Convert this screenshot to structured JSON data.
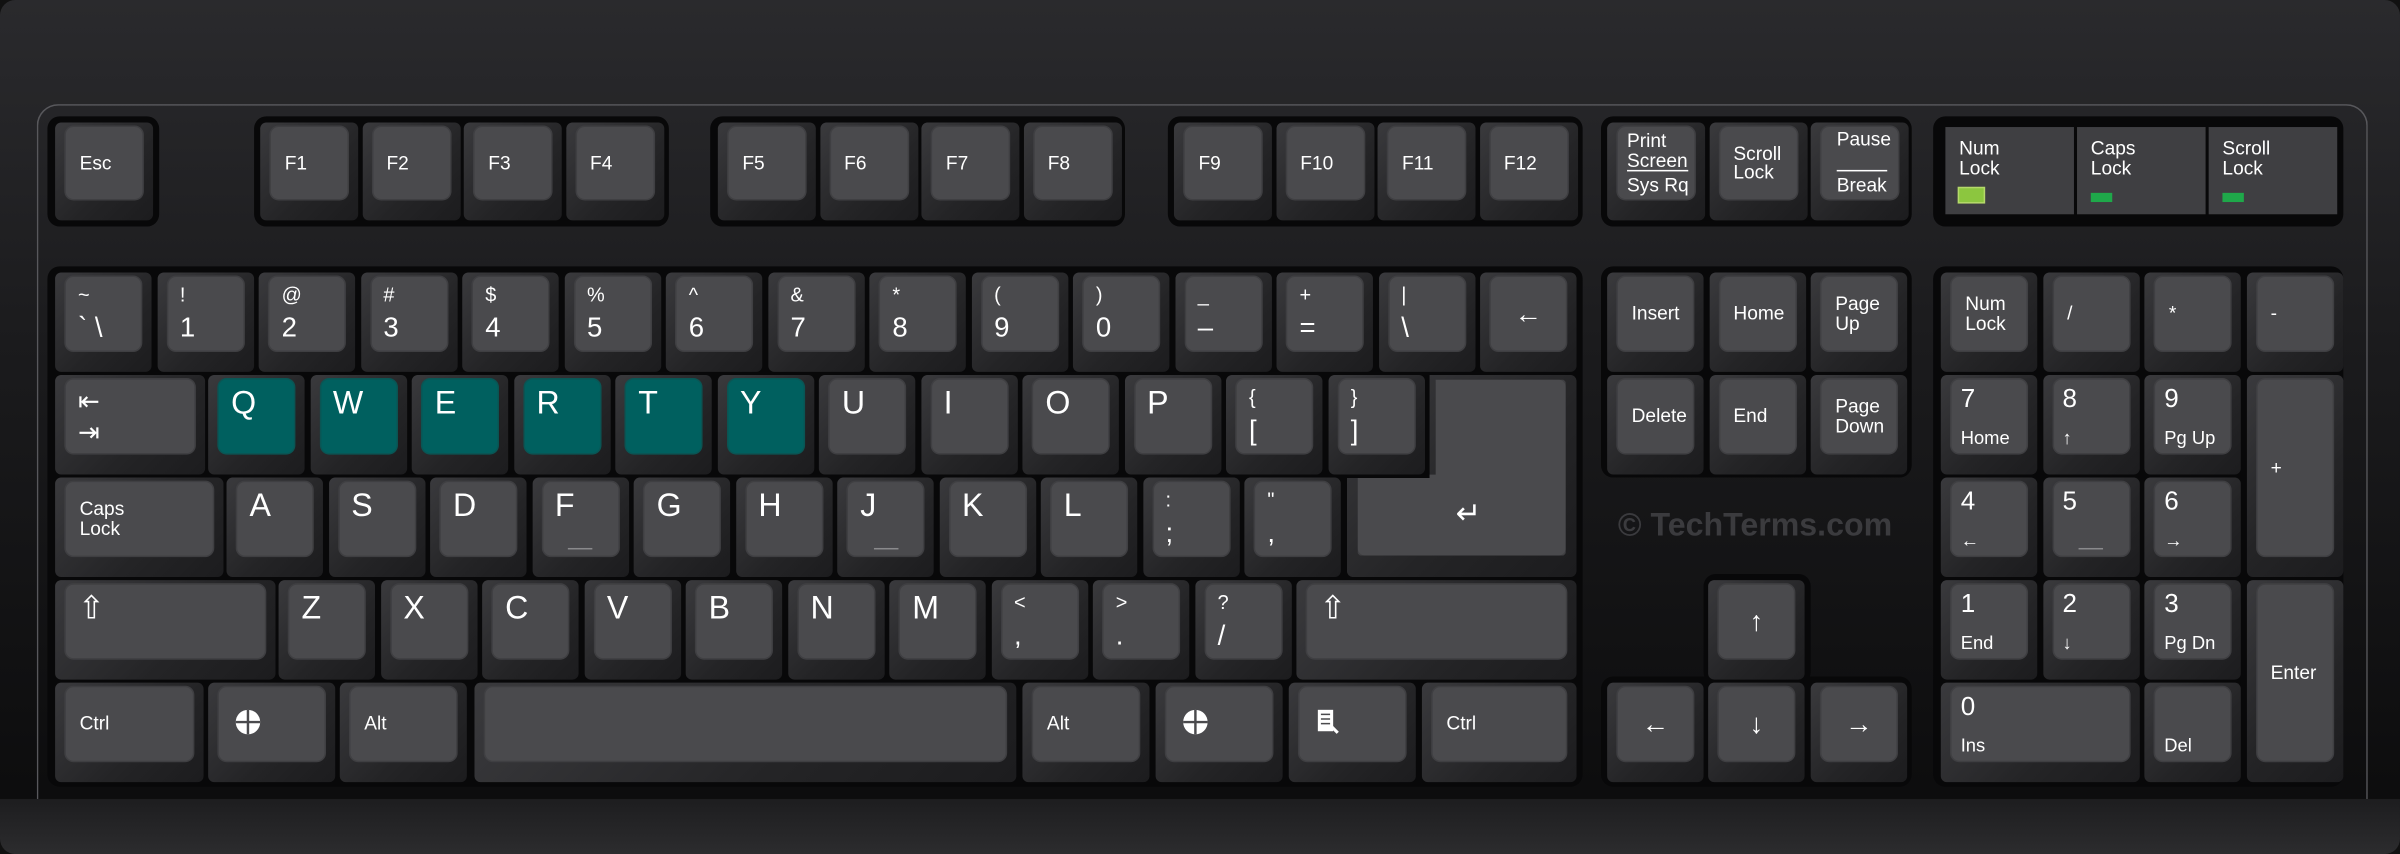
{
  "watermark": "© TechTerms.com",
  "highlight_color": "#00605f",
  "indicators": [
    {
      "label": "Num\nLock",
      "led_color": "#8cc63f",
      "state": "on"
    },
    {
      "label": "Caps\nLock",
      "led_color": "#1fa84a",
      "state": "off"
    },
    {
      "label": "Scroll\nLock",
      "led_color": "#1fa84a",
      "state": "off"
    }
  ],
  "keys": [
    {
      "id": "esc",
      "t": "Esc"
    },
    {
      "id": "f1",
      "t": "F1"
    },
    {
      "id": "f2",
      "t": "F2"
    },
    {
      "id": "f3",
      "t": "F3"
    },
    {
      "id": "f4",
      "t": "F4"
    },
    {
      "id": "f5",
      "t": "F5"
    },
    {
      "id": "f6",
      "t": "F6"
    },
    {
      "id": "f7",
      "t": "F7"
    },
    {
      "id": "f8",
      "t": "F8"
    },
    {
      "id": "f9",
      "t": "F9"
    },
    {
      "id": "f10",
      "t": "F10"
    },
    {
      "id": "f11",
      "t": "F11"
    },
    {
      "id": "f12",
      "t": "F12"
    },
    {
      "id": "prtsc",
      "t": "Print\nScreen",
      "b": "Sys Rq"
    },
    {
      "id": "scrlk",
      "t": "Scroll\nLock"
    },
    {
      "id": "pause",
      "t": "Pause",
      "b": "Break"
    },
    {
      "id": "tilde",
      "t": "~",
      "b": "`   \\"
    },
    {
      "id": "k1",
      "t": "!",
      "b": "1"
    },
    {
      "id": "k2",
      "t": "@",
      "b": "2"
    },
    {
      "id": "k3",
      "t": "#",
      "b": "3"
    },
    {
      "id": "k4",
      "t": "$",
      "b": "4"
    },
    {
      "id": "k5",
      "t": "%",
      "b": "5"
    },
    {
      "id": "k6",
      "t": "^",
      "b": "6"
    },
    {
      "id": "k7",
      "t": "&",
      "b": "7"
    },
    {
      "id": "k8",
      "t": "*",
      "b": "8"
    },
    {
      "id": "k9",
      "t": "(",
      "b": "9"
    },
    {
      "id": "k0",
      "t": ")",
      "b": "0"
    },
    {
      "id": "minus",
      "t": "_",
      "b": "–"
    },
    {
      "id": "equals",
      "t": "+",
      "b": "="
    },
    {
      "id": "pipe",
      "t": "|",
      "b": "\\"
    },
    {
      "id": "backspace",
      "t": "←"
    },
    {
      "id": "tab",
      "t": "⇤",
      "b": "⇥"
    },
    {
      "id": "q",
      "t": "Q",
      "hl": true
    },
    {
      "id": "w",
      "t": "W",
      "hl": true
    },
    {
      "id": "e",
      "t": "E",
      "hl": true
    },
    {
      "id": "r",
      "t": "R",
      "hl": true
    },
    {
      "id": "t",
      "t": "T",
      "hl": true
    },
    {
      "id": "y",
      "t": "Y",
      "hl": true
    },
    {
      "id": "u",
      "t": "U"
    },
    {
      "id": "i",
      "t": "I"
    },
    {
      "id": "o",
      "t": "O"
    },
    {
      "id": "p",
      "t": "P"
    },
    {
      "id": "lbrace",
      "t": "{",
      "b": "["
    },
    {
      "id": "rbrace",
      "t": "}",
      "b": "]"
    },
    {
      "id": "enter",
      "t": "↵"
    },
    {
      "id": "caps",
      "t": "Caps\nLock"
    },
    {
      "id": "a",
      "t": "A"
    },
    {
      "id": "s",
      "t": "S"
    },
    {
      "id": "d",
      "t": "D"
    },
    {
      "id": "f",
      "t": "F"
    },
    {
      "id": "g",
      "t": "G"
    },
    {
      "id": "h",
      "t": "H"
    },
    {
      "id": "j",
      "t": "J"
    },
    {
      "id": "k",
      "t": "K"
    },
    {
      "id": "l",
      "t": "L"
    },
    {
      "id": "semicolon",
      "t": ":",
      "b": ";"
    },
    {
      "id": "quote",
      "t": "\"",
      "b": ","
    },
    {
      "id": "lshift",
      "t": "⇧"
    },
    {
      "id": "z",
      "t": "Z"
    },
    {
      "id": "x",
      "t": "X"
    },
    {
      "id": "c",
      "t": "C"
    },
    {
      "id": "v",
      "t": "V"
    },
    {
      "id": "b",
      "t": "B"
    },
    {
      "id": "n",
      "t": "N"
    },
    {
      "id": "m",
      "t": "M"
    },
    {
      "id": "comma",
      "t": "<",
      "b": ","
    },
    {
      "id": "period",
      "t": ">",
      "b": "."
    },
    {
      "id": "slash",
      "t": "?",
      "b": "/"
    },
    {
      "id": "rshift",
      "t": "⇧"
    },
    {
      "id": "lctrl",
      "t": "Ctrl"
    },
    {
      "id": "lwin",
      "icon": "windows-logo"
    },
    {
      "id": "lalt",
      "t": "Alt"
    },
    {
      "id": "space",
      "t": ""
    },
    {
      "id": "ralt",
      "t": "Alt"
    },
    {
      "id": "rwin",
      "icon": "windows-logo"
    },
    {
      "id": "menu",
      "icon": "menu-document"
    },
    {
      "id": "rctrl",
      "t": "Ctrl"
    },
    {
      "id": "insert",
      "t": "Insert"
    },
    {
      "id": "home",
      "t": "Home"
    },
    {
      "id": "pgup",
      "t": "Page\nUp"
    },
    {
      "id": "delete",
      "t": "Delete"
    },
    {
      "id": "end",
      "t": "End"
    },
    {
      "id": "pgdn",
      "t": "Page\nDown"
    },
    {
      "id": "up",
      "t": "↑"
    },
    {
      "id": "left",
      "t": "←"
    },
    {
      "id": "down",
      "t": "↓"
    },
    {
      "id": "right",
      "t": "→"
    },
    {
      "id": "numlock",
      "t": "Num\nLock"
    },
    {
      "id": "npdiv",
      "t": "/"
    },
    {
      "id": "npmul",
      "t": "*"
    },
    {
      "id": "npsub",
      "t": "-"
    },
    {
      "id": "np7",
      "t": "7",
      "b": "Home"
    },
    {
      "id": "np8",
      "t": "8",
      "b": "↑"
    },
    {
      "id": "np9",
      "t": "9",
      "b": "Pg Up"
    },
    {
      "id": "npadd",
      "t": "+"
    },
    {
      "id": "np4",
      "t": "4",
      "b": "←"
    },
    {
      "id": "np5",
      "t": "5",
      "b": ""
    },
    {
      "id": "np6",
      "t": "6",
      "b": "→"
    },
    {
      "id": "np1",
      "t": "1",
      "b": "End"
    },
    {
      "id": "np2",
      "t": "2",
      "b": "↓"
    },
    {
      "id": "np3",
      "t": "3",
      "b": "Pg Dn"
    },
    {
      "id": "npenter",
      "t": "Enter"
    },
    {
      "id": "np0",
      "t": "0",
      "b": "Ins"
    },
    {
      "id": "npdel",
      "t": "",
      "b": "Del"
    }
  ]
}
